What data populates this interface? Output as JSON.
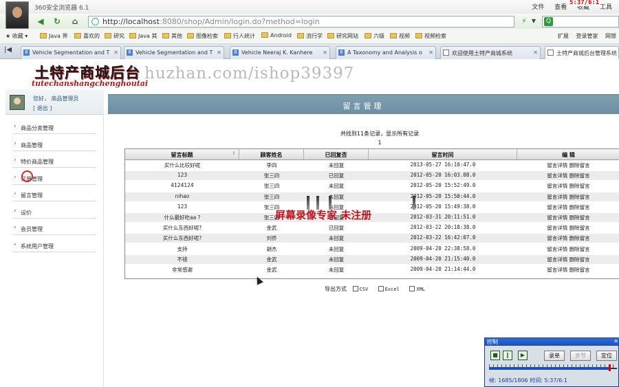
{
  "browser": {
    "title": "360安全浏览器 6.1",
    "menu": [
      "文件",
      "查看",
      "收藏",
      "工具"
    ],
    "recording_time": "5:37/6:1",
    "url_host": "http://localhost",
    "url_rest": ":8080/shop/Admin/login.do?method=login",
    "favorites_label": "收藏",
    "favorites": [
      "Java 界",
      "喜欢的",
      "研究",
      "Java 其",
      "其他",
      "图像检索",
      "行人统计",
      "Android",
      "流行学",
      "研究网站",
      "六级",
      "视频",
      "视频检索"
    ],
    "fav_right": [
      "扩展",
      "登录管家",
      "网银"
    ],
    "tabs": [
      {
        "label": "Vehicle Segmentation and T",
        "icon": "g-icon"
      },
      {
        "label": "Vehicle Segmentation and T",
        "icon": "g-icon"
      },
      {
        "label": "Vehicle Neeraj K. Kanhere",
        "icon": "g-icon"
      },
      {
        "label": "A Taxonomy and Analysis o",
        "icon": "g-icon"
      },
      {
        "label": "欢迎使用土特产商城系统",
        "icon": "page-icon"
      },
      {
        "label": "土特产商城后台管理系统",
        "icon": "page-icon"
      }
    ]
  },
  "site": {
    "logo": "土特产商城后台",
    "logo_pinyin": "tutechanshangchenghoutai",
    "watermark": "huzhan.com/ishop39397"
  },
  "sidebar": {
    "greeting": "您好，  商品管理员",
    "logout": "[  退出  ]",
    "items": [
      "商品分类管理",
      "商品管理",
      "特价商品管理",
      "订单管理",
      "留言管理",
      "设价",
      "会员管理",
      "系统用户管理"
    ]
  },
  "content": {
    "title": "留言管理",
    "records_info": "共找到11条记录，显示所有记录",
    "page": "1",
    "columns": [
      "留言标题",
      "顾客姓名",
      "已回复否",
      "留言时间",
      "编  辑"
    ],
    "rows": [
      {
        "title": "买什么比较好呢",
        "customer": "李四",
        "replied": "未回复",
        "time": "2013-05-27 16:10:47.0"
      },
      {
        "title": "123",
        "customer": "张三四",
        "replied": "已回复",
        "time": "2012-05-20 16:03.08.0"
      },
      {
        "title": "4124124",
        "customer": "张三四",
        "replied": "未回复",
        "time": "2012-05-20 15:52:49.0"
      },
      {
        "title": "nihao",
        "customer": "张三四",
        "replied": "未回复",
        "time": "2012-05-20 15:50:44.0"
      },
      {
        "title": "123",
        "customer": "张三四",
        "replied": "未回复",
        "time": "2012-05-20 15:49:38.0"
      },
      {
        "title": "什么最好吃aa ?",
        "customer": "张三四",
        "replied": "已回复",
        "time": "2012-03-31 20:11:51.0"
      },
      {
        "title": "买什么东西好呢?",
        "customer": "金武",
        "replied": "已回复",
        "time": "2012-03-22 20:18:38.0"
      },
      {
        "title": "买什么东西好呢?",
        "customer": "刘侨",
        "replied": "未回复",
        "time": "2012-03-22 16:42:07.0"
      },
      {
        "title": "支持",
        "customer": "胡杰",
        "replied": "未回复",
        "time": "2009-04-20 22:38:58.0"
      },
      {
        "title": "不错",
        "customer": "金武",
        "replied": "未回复",
        "time": "2009-04-20 21:15:40.0"
      },
      {
        "title": "非常感谢",
        "customer": "金武",
        "replied": "未回复",
        "time": "2009-04-20 21:14:44.0"
      }
    ],
    "row_action_detail": "留言详情",
    "row_action_delete": "删除留言",
    "export_label": "导出方式",
    "export_options": [
      "CSV",
      "Excel",
      "XML"
    ]
  },
  "overlay": {
    "text": "屏幕录像专家  未注册"
  },
  "recorder": {
    "title": "控制",
    "btn_record": "录单",
    "btn_step": "步节",
    "btn_locate": "定位",
    "status": "帧: 1685/1806 时间: 5:37/6:1",
    "progress": 0.933
  },
  "colors": {
    "header_band": "#7e9fb0",
    "logo_red": "#b21818",
    "overlay_red": "#c0141c",
    "recorder_blue": "#1a4fb5"
  }
}
